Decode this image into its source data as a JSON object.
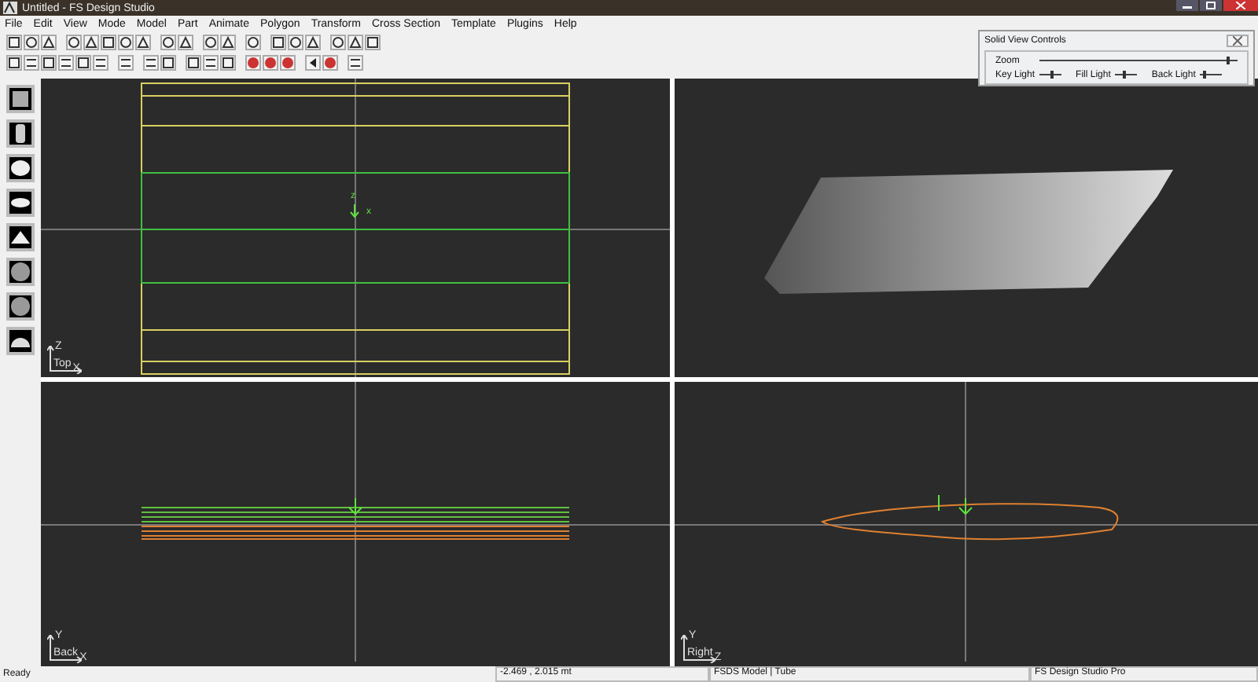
{
  "window": {
    "title": "Untitled - FS Design Studio"
  },
  "menu": [
    "File",
    "Edit",
    "View",
    "Mode",
    "Model",
    "Part",
    "Animate",
    "Polygon",
    "Transform",
    "Cross Section",
    "Template",
    "Plugins",
    "Help"
  ],
  "viewports": [
    {
      "kind": "top",
      "label": "Top",
      "v_axis": "Z",
      "h_axis": "X",
      "marker": {
        "v": "z",
        "h": "x"
      }
    },
    {
      "kind": "solid"
    },
    {
      "kind": "back",
      "label": "Back",
      "v_axis": "Y",
      "h_axis": "X"
    },
    {
      "kind": "right",
      "label": "Right",
      "v_axis": "Y",
      "h_axis": "Z"
    }
  ],
  "solid_view_controls": {
    "title": "Solid View Controls",
    "sliders": [
      {
        "label": "Zoom",
        "level": 0.95
      },
      {
        "label": "Key Light",
        "level": 0.6
      },
      {
        "label": "Fill Light",
        "level": 0.4
      },
      {
        "label": "Back Light",
        "level": 0.15
      }
    ]
  },
  "status_bar": [
    "Ready",
    "-2.469 , 2.015 mt",
    "FSDS Model | Tube",
    "FS Design Studio Pro"
  ]
}
